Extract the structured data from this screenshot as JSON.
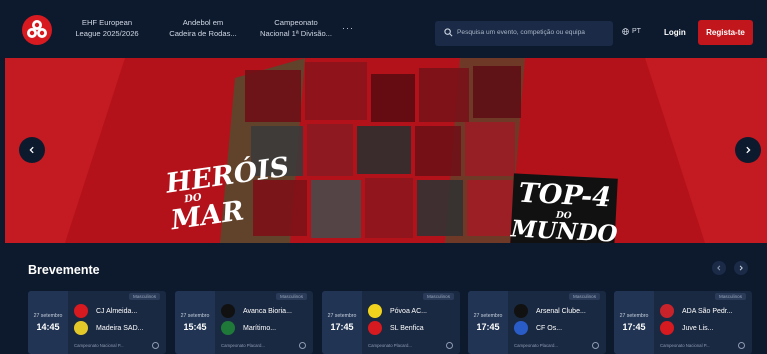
{
  "header": {
    "nav": [
      {
        "line1": "EHF European",
        "line2": "League 2025/2026"
      },
      {
        "line1": "Andebol em",
        "line2": "Cadeira de Rodas..."
      },
      {
        "line1": "Campeonato",
        "line2": "Nacional 1ª Divisão..."
      }
    ],
    "more": "···",
    "search_placeholder": "Pesquisa um evento, competição ou equipa",
    "language": "PT",
    "login": "Login",
    "register": "Regista-te",
    "brand_color": "#d71920"
  },
  "hero": {
    "left_title_big_1": "HERÓIS",
    "left_title_small": "DO",
    "left_title_big_2": "MAR",
    "right_title_big": "TOP-4",
    "right_title_small": "DO",
    "right_title_big_2": "MUNDO",
    "prev_icon": "chevron-left-icon",
    "next_icon": "chevron-right-icon"
  },
  "upcoming": {
    "title": "Brevemente",
    "cards": [
      {
        "date": "27 setembro",
        "time": "14:45",
        "badge": "Masculinos",
        "team1": "CJ Almeida...",
        "team2": "Madeira SAD...",
        "competition": "Campeonato Nacional P...",
        "crest1": "#d71920",
        "crest2": "#e3c82a"
      },
      {
        "date": "27 setembro",
        "time": "15:45",
        "badge": "Masculinos",
        "team1": "Avanca Bioria...",
        "team2": "Marítimo...",
        "competition": "Campeonato Placard...",
        "crest1": "#111111",
        "crest2": "#1f7a3a"
      },
      {
        "date": "27 setembro",
        "time": "17:45",
        "badge": "Masculinos",
        "team1": "Póvoa AC...",
        "team2": "SL Benfica",
        "competition": "Campeonato Placard...",
        "crest1": "#f1d21d",
        "crest2": "#d71920"
      },
      {
        "date": "27 setembro",
        "time": "17:45",
        "badge": "Masculinos",
        "team1": "Arsenal Clube...",
        "team2": "CF Os...",
        "competition": "Campeonato Placard...",
        "crest1": "#111111",
        "crest2": "#2a5cc7"
      },
      {
        "date": "27 setembro",
        "time": "17:45",
        "badge": "Masculinos",
        "team1": "ADA São Pedr...",
        "team2": "Juve Lis...",
        "competition": "Campeonato Nacional P...",
        "crest1": "#c8232b",
        "crest2": "#d71920"
      }
    ]
  }
}
